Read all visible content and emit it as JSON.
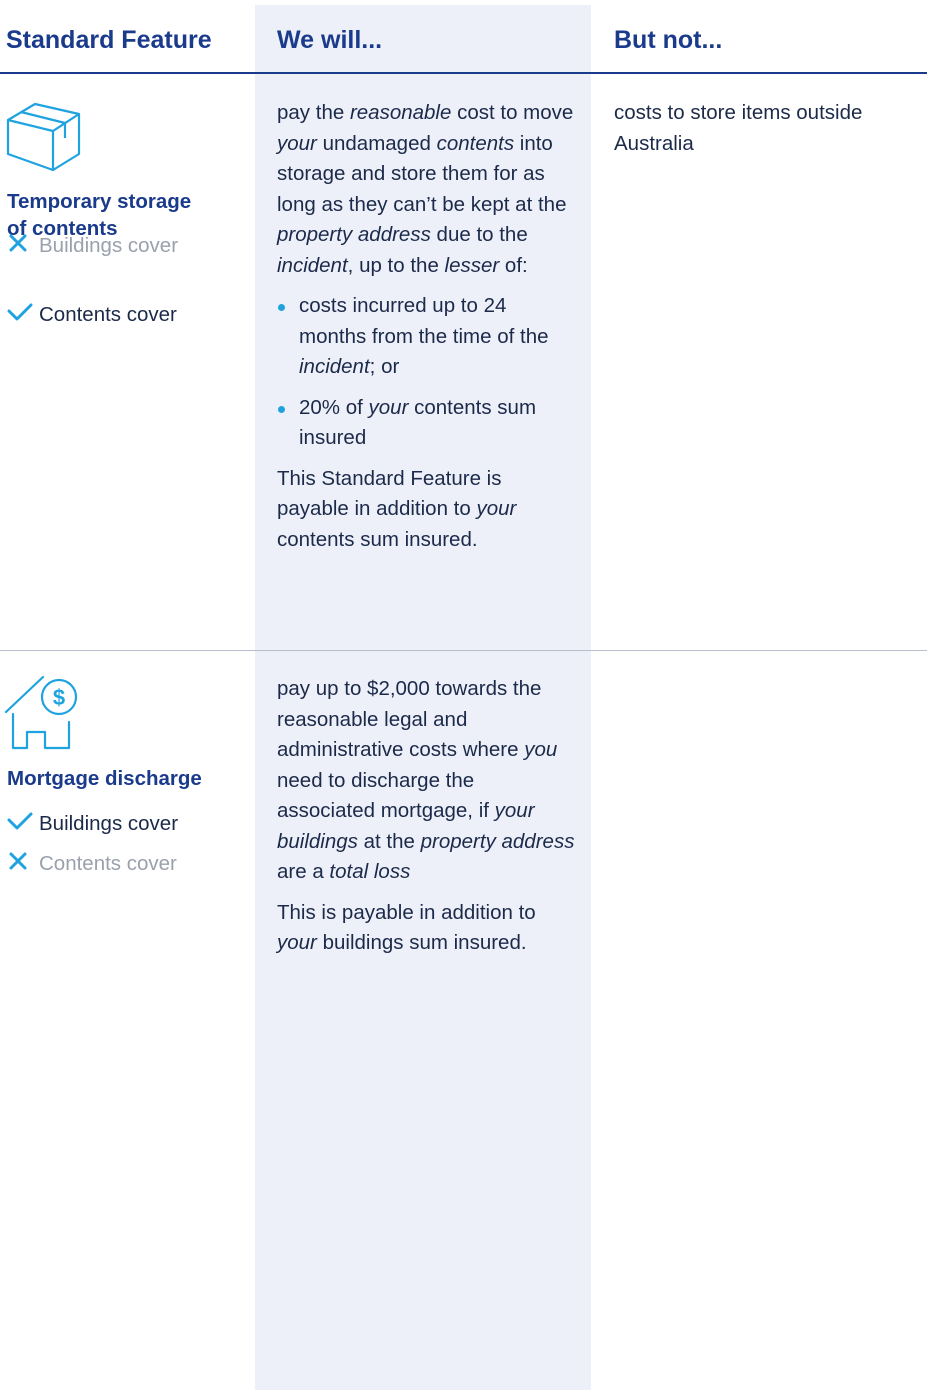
{
  "header": {
    "col1": "Standard Feature",
    "col2": "We will...",
    "col3": "But not..."
  },
  "rows": [
    {
      "icon": "box-icon",
      "title_line1": "Temporary storage",
      "title_line2": "of contents",
      "covers": [
        {
          "label": "Buildings cover",
          "included": false
        },
        {
          "label": "Contents cover",
          "included": true
        }
      ],
      "we_will": {
        "p1": {
          "t1": "pay the ",
          "e1": "reasonable",
          "t2": " cost to move ",
          "e2": "your",
          "t3": " undamaged ",
          "e3": "contents",
          "t4": " into storage and store them for as long as they can’t be kept at the ",
          "e4": "property address",
          "t5": " due to the ",
          "e5": "incident",
          "t6": ", up to the ",
          "e6": "lesser",
          "t7": " of:"
        },
        "b1": {
          "t1": "costs incurred up to 24 months from the time of the ",
          "e1": "incident",
          "t2": "; or"
        },
        "b2": {
          "t1": "20% of ",
          "e1": "your",
          "t2": " contents sum insured"
        },
        "p2": {
          "t1": "This Standard Feature is payable in addition to ",
          "e1": "your",
          "t2": " contents sum insured."
        }
      },
      "but_not": "costs to store items outside Australia"
    },
    {
      "icon": "house-dollar-icon",
      "title_line1": "Mortgage discharge",
      "covers": [
        {
          "label": "Buildings cover",
          "included": true
        },
        {
          "label": "Contents cover",
          "included": false
        }
      ],
      "we_will": {
        "p1": {
          "t1": "pay up to $2,000 towards the reasonable legal and administrative costs where ",
          "e1": "you",
          "t2": " need to discharge the associated mortgage, if ",
          "e2": "your buildings",
          "t3": " at the ",
          "e3": "property address",
          "t4": " are a ",
          "e4": "total loss"
        },
        "p2": {
          "t1": "This is payable in addition to ",
          "e1": "your",
          "t2": " buildings sum insured."
        }
      },
      "but_not": ""
    }
  ],
  "colors": {
    "navy": "#1a3a8c",
    "accent": "#1fa3e0",
    "muted": "#9aa1ad",
    "shade": "#edf0f8"
  }
}
